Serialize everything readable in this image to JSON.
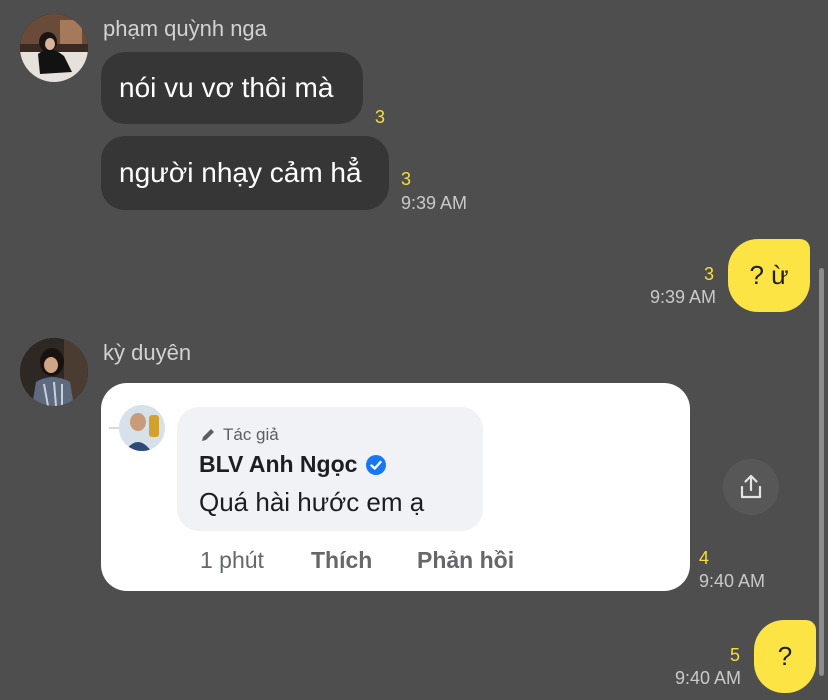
{
  "colors": {
    "background": "#4e4e4e",
    "incoming_bubble": "#363636",
    "outgoing_bubble": "#fbe443",
    "unread_count": "#f6df3a",
    "verified_badge": "#1877f2"
  },
  "messages": [
    {
      "sender": "phạm quỳnh nga",
      "avatar_icon": "profile-photo",
      "bubbles": [
        {
          "text": "nói vu vơ thôi mà",
          "unread": "3"
        },
        {
          "text": "người nhạy cảm hẳ",
          "unread": "3",
          "time": "9:39 AM"
        }
      ]
    },
    {
      "outgoing": true,
      "text": "? ừ",
      "unread": "3",
      "time": "9:39 AM"
    },
    {
      "sender": "kỳ duyên",
      "avatar_icon": "profile-photo",
      "shared_image": {
        "role_icon": "pencil-icon",
        "role": "Tác giả",
        "name": "BLV Anh Ngọc",
        "badge_icon": "verified-badge-icon",
        "comment": "Quá hài hước em ạ",
        "actions": [
          "1 phút",
          "Thích",
          "Phản hồi"
        ]
      },
      "unread": "4",
      "time": "9:40 AM",
      "share_icon": "share-icon"
    },
    {
      "outgoing": true,
      "text": "?",
      "unread": "5",
      "time": "9:40 AM"
    }
  ]
}
